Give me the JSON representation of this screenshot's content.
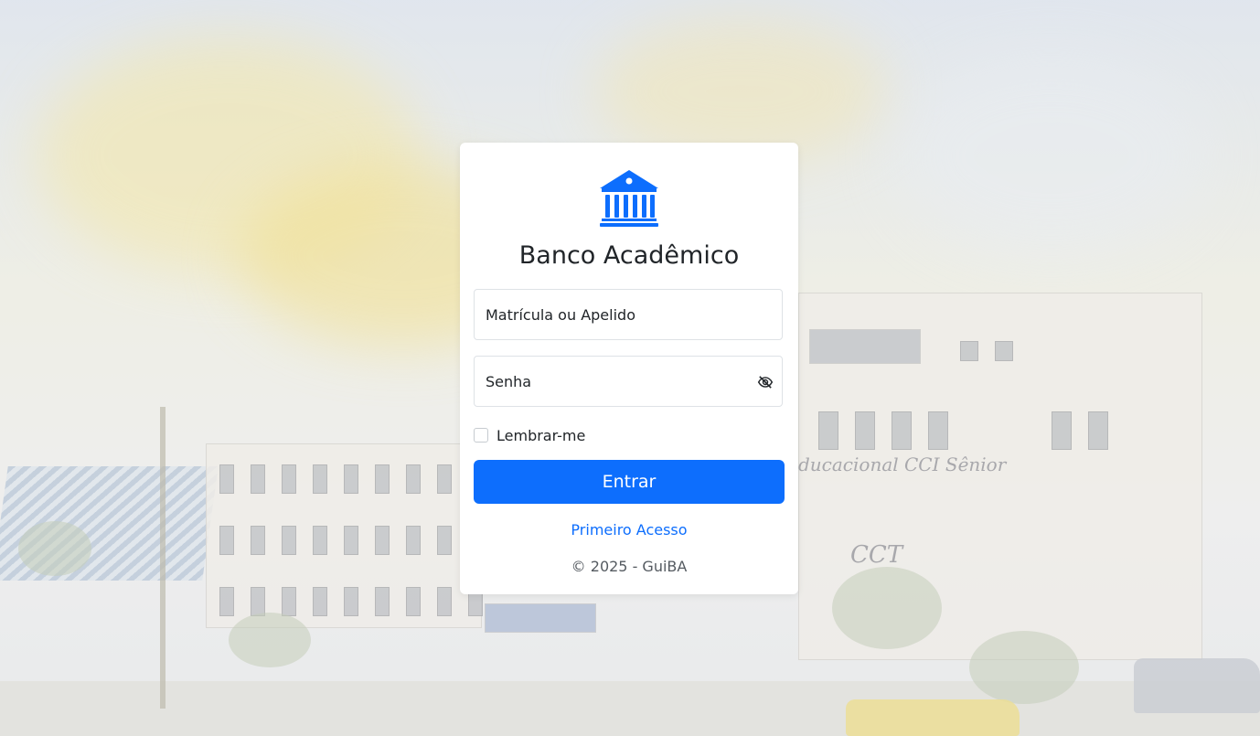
{
  "app": {
    "title": "Banco Acadêmico",
    "logo_icon": "bank-icon",
    "accent_color": "#0d6efd"
  },
  "login": {
    "username_placeholder": "Matrícula ou Apelido",
    "username_value": "",
    "password_placeholder": "Senha",
    "password_value": "",
    "password_toggle_icon": "eye-slash-icon",
    "remember_label": "Lembrar-me",
    "remember_checked": false,
    "submit_label": "Entrar",
    "first_access_label": "Primeiro Acesso",
    "copyright": "© 2025 - GuiBA"
  },
  "background": {
    "sign_text": "ducacional CCI Sênior",
    "sign_small": "CCT"
  }
}
